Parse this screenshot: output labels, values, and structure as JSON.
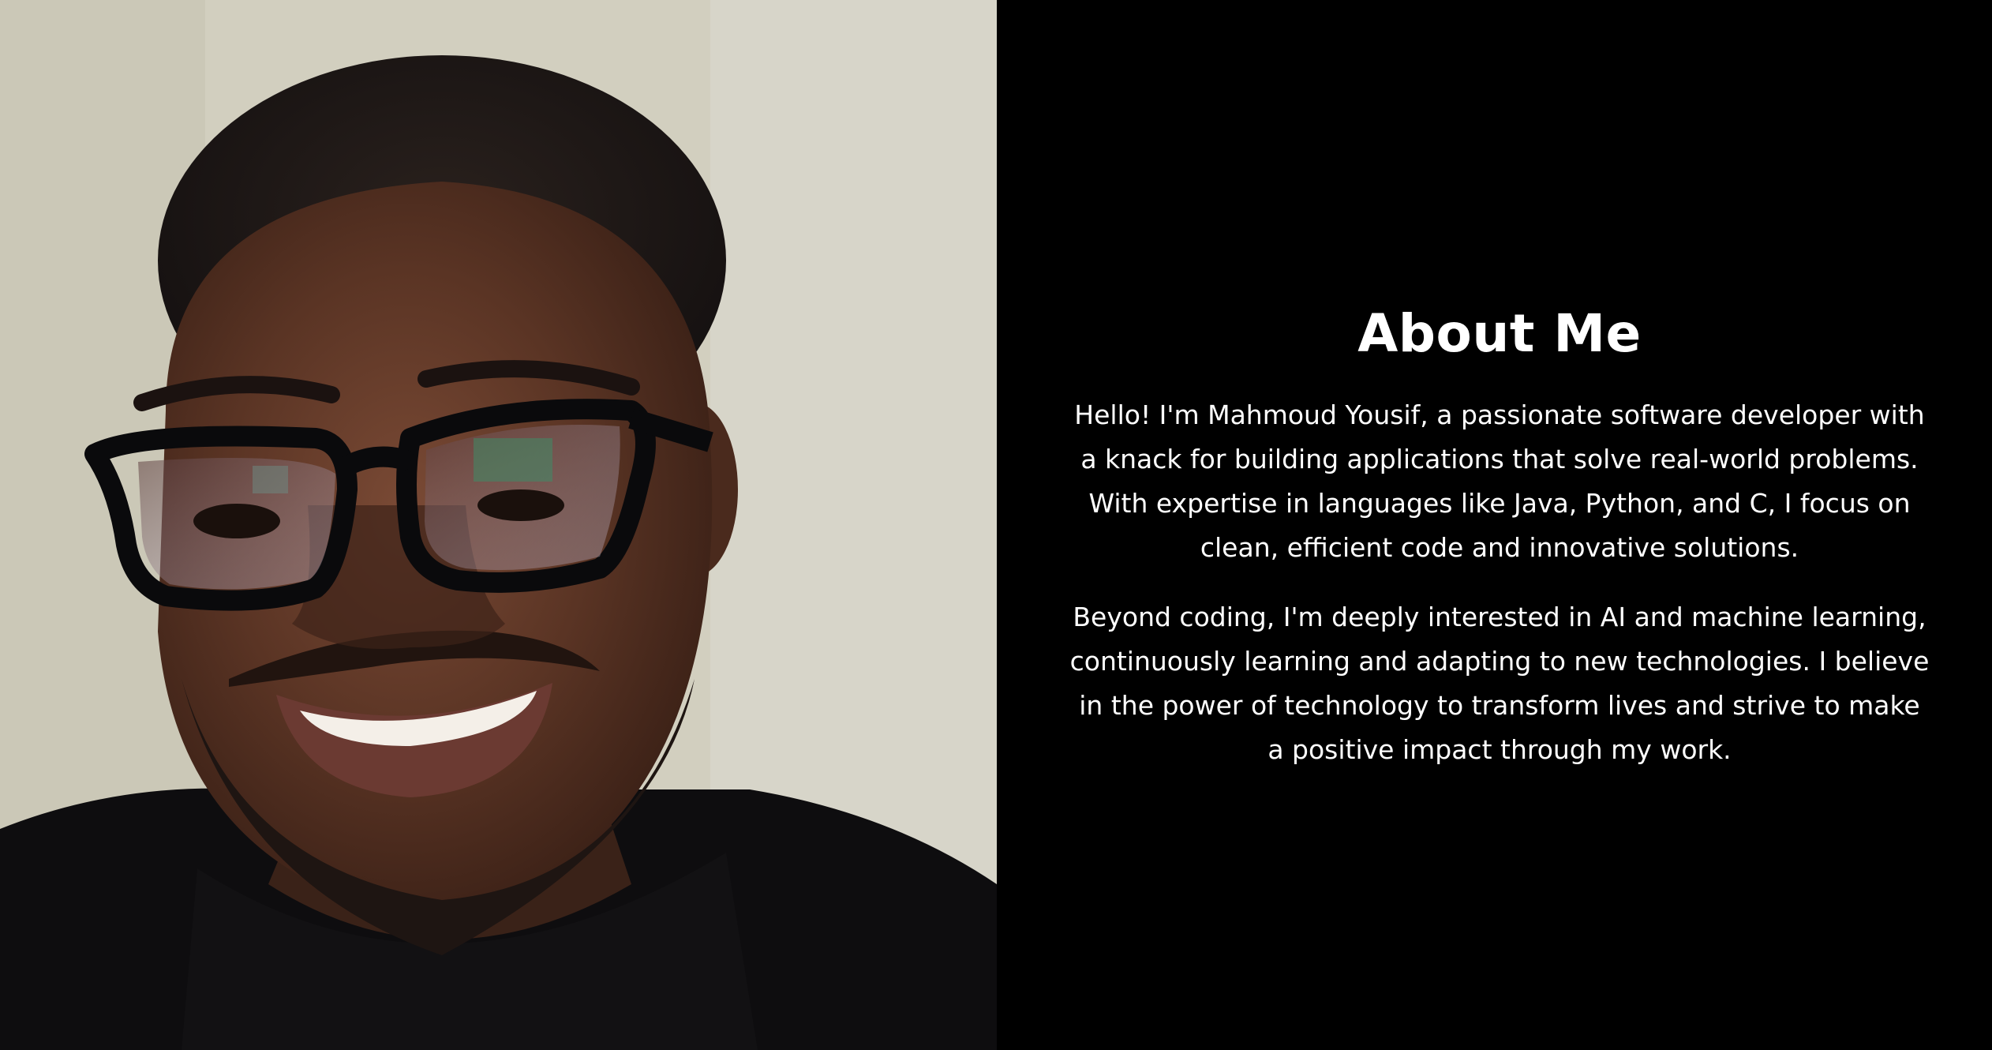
{
  "about": {
    "title": "About Me",
    "paragraphs": [
      "Hello! I'm Mahmoud Yousif, a passionate software developer with a knack for building applications that solve real-world problems. With expertise in languages like Java, Python, and C, I focus on clean, efficient code and innovative solutions.",
      "Beyond coding, I'm deeply interested in AI and machine learning, continuously learning and adapting to new technologies. I believe in the power of technology to transform lives and strive to make a positive impact through my work."
    ]
  },
  "photo": {
    "icon": "portrait-photo"
  },
  "colors": {
    "background": "#000000",
    "text": "#ffffff"
  }
}
